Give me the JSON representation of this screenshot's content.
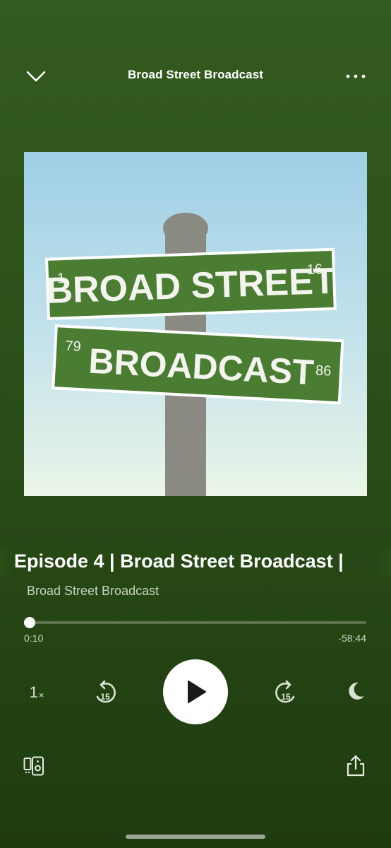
{
  "header": {
    "title": "Broad Street Broadcast",
    "collapse_icon": "chevron-down-icon",
    "more_icon": "more-horizontal-icon"
  },
  "artwork": {
    "sign_top_text": "BROAD STREET",
    "sign_top_left_num": "1",
    "sign_top_right_num": "16",
    "sign_bottom_text": "BROADCAST",
    "sign_bottom_left_num": "79",
    "sign_bottom_right_num": "86"
  },
  "episode": {
    "title": "Episode 4 | Broad Street Broadcast |",
    "show": "Broad Street Broadcast"
  },
  "progress": {
    "elapsed": "0:10",
    "remaining": "-58:44",
    "fraction": 0.003
  },
  "controls": {
    "speed": "1",
    "speed_suffix": "×",
    "skip_back": "15",
    "skip_forward": "15",
    "play_icon": "play-icon",
    "sleep_icon": "moon-icon",
    "devices_icon": "devices-icon",
    "share_icon": "share-icon"
  },
  "colors": {
    "background": "#2c511a",
    "sign_green": "#4a7c32",
    "sky": "#a8d4e8"
  }
}
